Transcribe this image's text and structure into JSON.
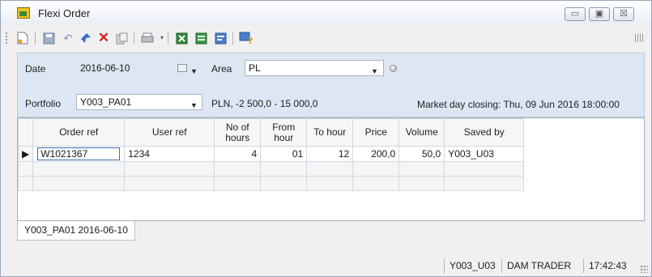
{
  "window": {
    "title": "Flexi Order",
    "minimize": "▭",
    "maximize": "▣",
    "close": "☒"
  },
  "toolbar": {
    "icons": [
      "new-icon",
      "save-icon",
      "undo-icon",
      "send-icon",
      "delete-icon",
      "copy-icon",
      "print-icon",
      "excel-icon",
      "import-icon",
      "export-icon",
      "help-icon"
    ]
  },
  "filters": {
    "date_label": "Date",
    "date_value": "2016-06-10",
    "area_label": "Area",
    "area_value": "PL",
    "portfolio_label": "Portfolio",
    "portfolio_value": "Y003_PA01",
    "limits_text": "PLN, -2 500,0 - 15 000,0",
    "market_closing": "Market day closing: Thu, 09 Jun 2016 18:00:00"
  },
  "grid": {
    "columns": [
      "Order ref",
      "User ref",
      "No of hours",
      "From hour",
      "To hour",
      "Price",
      "Volume",
      "Saved by"
    ],
    "rows": [
      {
        "order_ref": "W1021367",
        "user_ref": "1234",
        "no_of_hours": "4",
        "from_hour": "01",
        "to_hour": "12",
        "price": "200,0",
        "volume": "50,0",
        "saved_by": "Y003_U03"
      }
    ],
    "row_marker": "▶"
  },
  "tabs": [
    {
      "label": "Y003_PA01 2016-06-10"
    }
  ],
  "status": {
    "user": "Y003_U03",
    "role": "DAM TRADER",
    "time": "17:42:43"
  },
  "colors": {
    "panel": "#dde6f2",
    "selection_border": "#3a6fb0"
  }
}
